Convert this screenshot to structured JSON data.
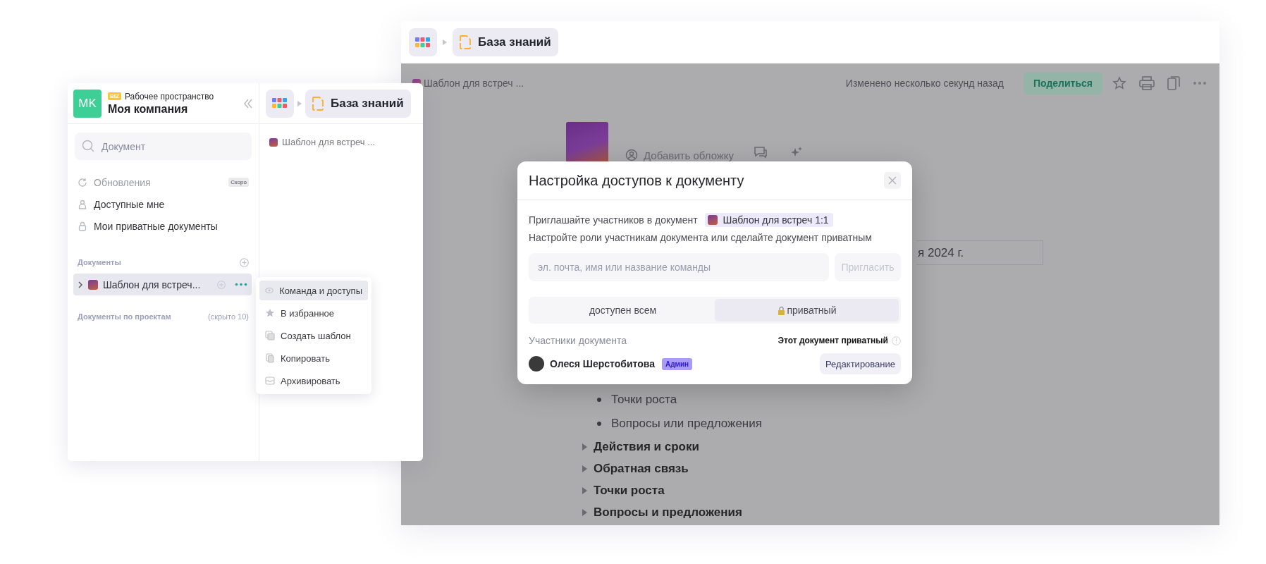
{
  "left_window": {
    "workspace": {
      "initials": "MK",
      "plan_badge": "BIZ",
      "label": "Рабочее пространство",
      "name": "Моя компания"
    },
    "search": {
      "placeholder": "Документ"
    },
    "nav": [
      {
        "label": "Обновления",
        "badge": "Скоро",
        "disabled": true
      },
      {
        "label": "Доступные мне",
        "disabled": false
      },
      {
        "label": "Мои приватные документы",
        "disabled": false
      }
    ],
    "documents_section": {
      "title": "Документы",
      "items": [
        {
          "label": "Шаблон для встреч...",
          "selected": true,
          "expanded": false
        }
      ]
    },
    "projects_section": {
      "title": "Документы по проектам",
      "hidden_count": "(скрыто 10)"
    },
    "breadcrumb": {
      "label": "База знаний"
    },
    "page_links": [
      "Шаблон для встреч ..."
    ],
    "context_menu": [
      {
        "label": "Команда и доступы",
        "selected": true
      },
      {
        "label": "В избранное",
        "selected": false
      },
      {
        "label": "Создать шаблон",
        "selected": false
      },
      {
        "label": "Копировать",
        "selected": false
      },
      {
        "label": "Архивировать",
        "selected": false
      }
    ]
  },
  "right_window": {
    "breadcrumb": {
      "label": "База знаний"
    },
    "doc_bar": {
      "title": "Шаблон для встреч ...",
      "status": "Изменено несколько секунд назад",
      "share_button": "Поделиться"
    },
    "cover_action": "Добавить обложку",
    "date_field": "я 2024 г.",
    "bullets": [
      "Точки роста",
      "Вопросы или предложения"
    ],
    "toggles": [
      {
        "label": "Действия и сроки",
        "expanded": false
      },
      {
        "label": "Обратная связь",
        "expanded": false
      },
      {
        "label": "Точки роста",
        "expanded": false
      },
      {
        "label": "Вопросы и предложения",
        "expanded": false
      }
    ]
  },
  "dialog": {
    "title": "Настройка доступов к документу",
    "invite_text": "Приглашайте участников в документ",
    "doc_chip": "Шаблон для встреч 1:1",
    "hint": "Настройте роли участникам документа или сделайте документ приватным",
    "input_placeholder": "эл. почта, имя или название команды",
    "invite_button": {
      "label": "Пригласить",
      "disabled": true
    },
    "access_options": [
      {
        "label": "доступен всем",
        "selected": false
      },
      {
        "label": "приватный",
        "selected": true
      }
    ],
    "members_label": "Участники документа",
    "privacy_note": "Этот документ приватный",
    "members": [
      {
        "name": "Олеся Шерстобитова",
        "role_badge": "Админ",
        "permission": "Редактирование"
      }
    ]
  }
}
